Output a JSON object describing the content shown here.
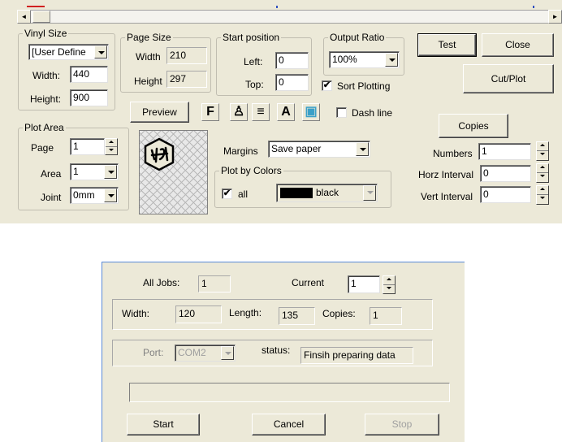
{
  "colors": {
    "panel_bg": "#ece9d8",
    "dialog_border": "#5a8ad8",
    "swatch_black": "#000000"
  },
  "scrollbar": {
    "left_arrow": "◄",
    "right_arrow": "►"
  },
  "vinyl_size": {
    "label": "Vinyl Size",
    "preset": "[User Define",
    "width_label": "Width:",
    "width_value": "440",
    "height_label": "Height:",
    "height_value": "900"
  },
  "page_size": {
    "label": "Page Size",
    "width_label": "Width",
    "width_value": "210",
    "height_label": "Height",
    "height_value": "297"
  },
  "start_position": {
    "label": "Start position",
    "left_label": "Left:",
    "left_value": "0",
    "top_label": "Top:",
    "top_value": "0"
  },
  "output_ratio": {
    "label": "Output Ratio",
    "value": "100%"
  },
  "sort_plotting": {
    "label": "Sort Plotting",
    "checked": true,
    "mark": "✔"
  },
  "buttons": {
    "test": "Test",
    "close": "Close",
    "cut_plot": "Cut/Plot",
    "preview": "Preview",
    "copies": "Copies"
  },
  "toolbar": {
    "f_glyph": "F",
    "person_glyph": "♙",
    "lines_glyph": "≡",
    "text_glyph": "A",
    "image_glyph": "▣"
  },
  "dash_line": {
    "label": "Dash line",
    "checked": false
  },
  "plot_area": {
    "label": "Plot Area",
    "page_label": "Page",
    "page_value": "1",
    "area_label": "Area",
    "area_value": "1",
    "joint_label": "Joint",
    "joint_value": "0mm"
  },
  "margins": {
    "label": "Margins",
    "value": "Save paper"
  },
  "plot_by_colors": {
    "label": "Plot by Colors",
    "all_label": "all",
    "all_checked": true,
    "all_mark": "✔",
    "color_name": "black"
  },
  "copies_panel": {
    "numbers_label": "Numbers",
    "numbers_value": "1",
    "horz_label": "Horz Interval",
    "horz_value": "0",
    "vert_label": "Vert Interval",
    "vert_value": "0"
  },
  "job_dialog": {
    "all_jobs_label": "All Jobs:",
    "all_jobs_value": "1",
    "current_label": "Current",
    "current_value": "1",
    "width_label": "Width:",
    "width_value": "120",
    "length_label": "Length:",
    "length_value": "135",
    "copies_label": "Copies:",
    "copies_value": "1",
    "port_label": "Port:",
    "port_value": "COM2",
    "status_label": "status:",
    "status_value": "Finsih preparing data",
    "progress": 0,
    "start_button": "Start",
    "cancel_button": "Cancel",
    "stop_button": "Stop"
  }
}
